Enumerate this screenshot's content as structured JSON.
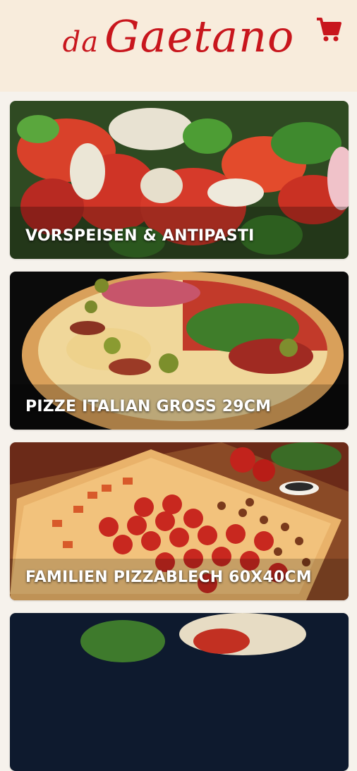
{
  "header": {
    "logo_prefix": "da",
    "logo_name": "Gaetano",
    "cart_icon": "shopping-cart-icon",
    "brand_color": "#c8161d",
    "background": "#f8ecdc"
  },
  "categories": [
    {
      "label": "VORSPEISEN & ANTIPASTI",
      "image": "salad-tomato-mozzarella"
    },
    {
      "label": "PIZZE ITALIAN GROSS 29CM",
      "image": "round-pizza"
    },
    {
      "label": "FAMILIEN PIZZABLECH 60X40CM",
      "image": "sheet-pizza-pepperoni"
    },
    {
      "label": "",
      "image": "pizza-partial"
    }
  ]
}
